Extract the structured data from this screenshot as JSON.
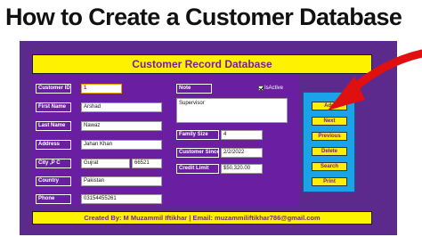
{
  "banner": {
    "title": "How to Create a Customer Database"
  },
  "form": {
    "title": "Customer Record Database",
    "fields": {
      "customer_id": {
        "label": "Customer ID",
        "value": "1"
      },
      "first_name": {
        "label": "First Name",
        "value": "Arshad"
      },
      "last_name": {
        "label": "Last Name",
        "value": "Nawaz"
      },
      "address": {
        "label": "Address",
        "value": "Jahan Khan"
      },
      "city_pc": {
        "label": "City ,P C",
        "city": "Gujrat",
        "postal_code": "66521"
      },
      "country": {
        "label": "Country",
        "value": "Pakistan"
      },
      "phone": {
        "label": "Phone",
        "value": "03154455261"
      },
      "note": {
        "label": "Note",
        "value": "Supervisor"
      },
      "is_active": {
        "label": "IsActive",
        "checked": true
      },
      "family_size": {
        "label": "Family Size",
        "value": "4"
      },
      "customer_since": {
        "label": "Customer Since",
        "value": "2/2/2022"
      },
      "credit_limit": {
        "label": "Credit Limit",
        "value": "$50,320.00"
      }
    },
    "buttons": {
      "add": "Add",
      "next": "Next",
      "previous": "Previous",
      "delete": "Delete",
      "search": "Search",
      "print": "Print"
    },
    "footer": "Created By: M Muzammil Iftikhar | Email: muzammiliftikhar786@gmail.com"
  },
  "colors": {
    "frame": "#5b2a8c",
    "panel": "#6a1fa2",
    "title_bar": "#fff200",
    "button_panel": "#1aa3e8",
    "button": "#ffee00",
    "arrow": "#e01010"
  },
  "icons": {
    "arrow": "red-arrow-icon",
    "checkbox": "checkbox-icon"
  }
}
